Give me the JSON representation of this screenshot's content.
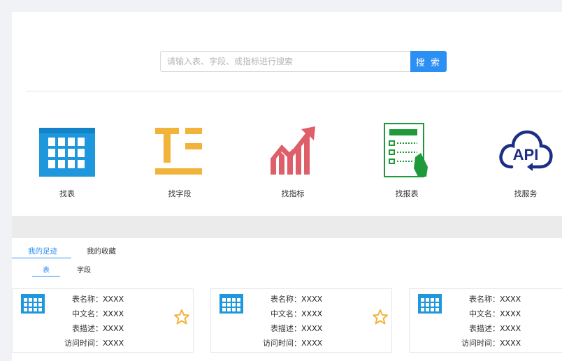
{
  "search": {
    "placeholder": "请输入表、字段、或指标进行搜索",
    "button_label": "搜 索"
  },
  "categories": [
    {
      "label": "找表",
      "icon": "table-grid-icon"
    },
    {
      "label": "找字段",
      "icon": "field-icon"
    },
    {
      "label": "找指标",
      "icon": "metric-chart-icon"
    },
    {
      "label": "找报表",
      "icon": "report-icon"
    },
    {
      "label": "找服务",
      "icon": "api-cloud-icon"
    }
  ],
  "tabs": [
    {
      "label": "我的足迹",
      "active": true
    },
    {
      "label": "我的收藏",
      "active": false
    }
  ],
  "subtabs": [
    {
      "label": "表",
      "active": true
    },
    {
      "label": "字段",
      "active": false
    }
  ],
  "cards": [
    {
      "fields": [
        {
          "key": "表名称：",
          "value": "XXXX"
        },
        {
          "key": "中文名：",
          "value": "XXXX"
        },
        {
          "key": "表描述：",
          "value": "XXXX"
        },
        {
          "key": "访问时间：",
          "value": "XXXX"
        }
      ]
    },
    {
      "fields": [
        {
          "key": "表名称：",
          "value": "XXXX"
        },
        {
          "key": "中文名：",
          "value": "XXXX"
        },
        {
          "key": "表描述：",
          "value": "XXXX"
        },
        {
          "key": "访问时间：",
          "value": "XXXX"
        }
      ]
    },
    {
      "fields": [
        {
          "key": "表名称：",
          "value": "XXXX"
        },
        {
          "key": "中文名：",
          "value": "XXXX"
        },
        {
          "key": "表描述：",
          "value": "XXXX"
        },
        {
          "key": "访问时间：",
          "value": "XXXX"
        }
      ]
    }
  ],
  "colors": {
    "accent": "#2b8ff3",
    "table_icon": "#1f97dd",
    "field_icon": "#f2b33a",
    "metric_icon": "#de5e6a",
    "report_icon": "#1e9a3a",
    "api_icon": "#1c2f85",
    "star": "#f2b33a"
  }
}
